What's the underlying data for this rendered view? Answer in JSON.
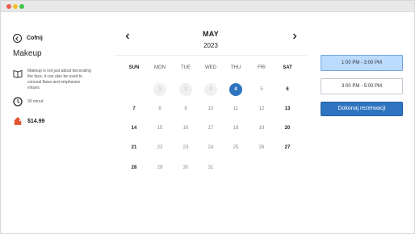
{
  "colors": {
    "accent": "#2f74c0",
    "slot_active": "#bcdcff",
    "past_day": "#f0f0f0",
    "window_red": "#f25b50",
    "window_yellow": "#f6be2f",
    "window_green": "#3cc84a"
  },
  "service": {
    "back_label": "Cofnij",
    "title": "Makeup",
    "description": "Makeup is not just about decorating the face, it can also be used to conceal flaws and emphasize virtues.",
    "duration": "30 minut",
    "price": "$14.99"
  },
  "calendar": {
    "month": "MAY",
    "year": "2023",
    "weekdays": [
      "SUN",
      "MON",
      "TUE",
      "WED",
      "THU",
      "FRI",
      "SAT"
    ],
    "weeks": [
      [
        "",
        "1",
        "2",
        "3",
        "4",
        "5",
        "6"
      ],
      [
        "7",
        "8",
        "9",
        "10",
        "11",
        "12",
        "13"
      ],
      [
        "14",
        "15",
        "16",
        "17",
        "18",
        "19",
        "20"
      ],
      [
        "21",
        "22",
        "23",
        "24",
        "25",
        "26",
        "27"
      ],
      [
        "28",
        "29",
        "30",
        "31",
        "",
        "",
        ""
      ]
    ],
    "past_days": [
      "1",
      "2",
      "3"
    ],
    "selected_day": "4"
  },
  "time_slots": [
    {
      "label": "1:00 PM - 3:00 PM",
      "active": true
    },
    {
      "label": "3:00 PM - 5:00 PM",
      "active": false
    }
  ],
  "book_button": "Dokonaj rezerwacji"
}
